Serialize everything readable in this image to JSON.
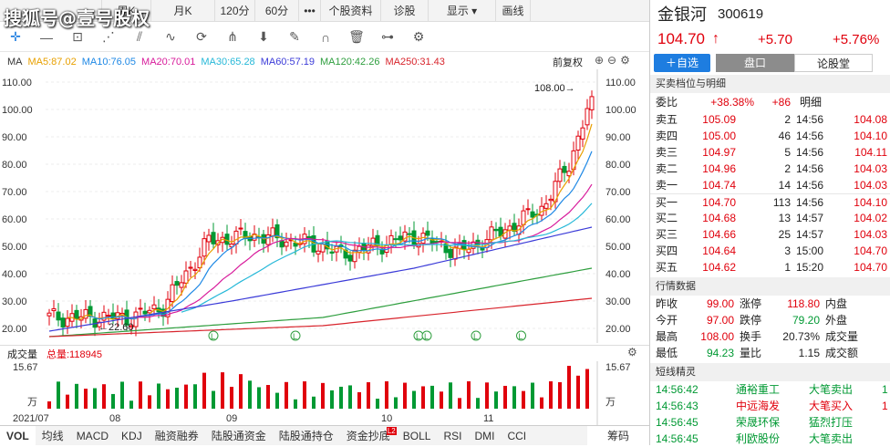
{
  "watermark": "搜狐号@壹号股权",
  "topbar": {
    "items": [
      "",
      "周K",
      "月K",
      "120分",
      "60分",
      "•••",
      "个股资料",
      "诊股",
      "显示 ▾",
      "画线"
    ]
  },
  "colors": {
    "up": "#e0000c",
    "down": "#009933"
  },
  "toolbar_icons": [
    "crosshair-icon",
    "line-icon",
    "rect-icon",
    "fan-icon",
    "parallel-icon",
    "wave-icon",
    "cycle-icon",
    "fork-icon",
    "arrow-down-icon",
    "pen-icon",
    "magnet-icon",
    "trash-icon",
    "split-icon",
    "settings-icon"
  ],
  "ma": {
    "label": "MA",
    "items": [
      {
        "label": "MA5:87.02",
        "color": "#e8a000"
      },
      {
        "label": "MA10:76.05",
        "color": "#1e88e5"
      },
      {
        "label": "MA20:70.01",
        "color": "#d81b9b"
      },
      {
        "label": "MA30:65.28",
        "color": "#26b8d8"
      },
      {
        "label": "MA60:57.19",
        "color": "#3b3bd8"
      },
      {
        "label": "MA120:42.26",
        "color": "#2e9e3e"
      },
      {
        "label": "MA250:31.43",
        "color": "#d8242c"
      }
    ],
    "adjust": "前复权",
    "high_label": "108.00→",
    "low_label": "←22.60"
  },
  "vol": {
    "label": "成交量",
    "total": "总量:118945",
    "axis_top": "15.67",
    "axis_unit": "万"
  },
  "xaxis": [
    "2021/07",
    "08",
    "09",
    "10",
    "11"
  ],
  "yaxis": [
    "110.00",
    "100.00",
    "90.00",
    "80.00",
    "70.00",
    "60.00",
    "50.00",
    "40.00",
    "30.00",
    "20.00"
  ],
  "bottom_tabs": [
    "VOL",
    "均线",
    "MACD",
    "KDJ",
    "融资融券",
    "陆股通资金",
    "陆股通持仓",
    "资金抄底",
    "BOLL",
    "RSI",
    "DMI",
    "CCI"
  ],
  "bottom_badge": "L2",
  "bottom_right": "筹码",
  "stock": {
    "name": "金银河",
    "code": "300619",
    "price": "104.70",
    "arrow": "↑",
    "change": "+5.70",
    "pct": "+5.76%"
  },
  "tabs": {
    "add": "＋自选",
    "quote": "盘口",
    "forum": "论股堂"
  },
  "orderbook": {
    "title": "买卖档位与明细",
    "weibi_label": "委比",
    "weibi": "+38.38%",
    "weicha": "+86",
    "detail_label": "明细",
    "sells": [
      {
        "label": "卖五",
        "price": "105.09",
        "vol": "2"
      },
      {
        "label": "卖四",
        "price": "105.00",
        "vol": "46"
      },
      {
        "label": "卖三",
        "price": "104.97",
        "vol": "5"
      },
      {
        "label": "卖二",
        "price": "104.96",
        "vol": "2"
      },
      {
        "label": "卖一",
        "price": "104.74",
        "vol": "14"
      }
    ],
    "buys": [
      {
        "label": "买一",
        "price": "104.70",
        "vol": "113"
      },
      {
        "label": "买二",
        "price": "104.68",
        "vol": "13"
      },
      {
        "label": "买三",
        "price": "104.66",
        "vol": "25"
      },
      {
        "label": "买四",
        "price": "104.64",
        "vol": "3"
      },
      {
        "label": "买五",
        "price": "104.62",
        "vol": "1"
      }
    ],
    "details": [
      {
        "time": "14:56",
        "price": "104.08"
      },
      {
        "time": "14:56",
        "price": "104.10"
      },
      {
        "time": "14:56",
        "price": "104.11"
      },
      {
        "time": "14:56",
        "price": "104.03"
      },
      {
        "time": "14:56",
        "price": "104.03"
      },
      {
        "time": "14:56",
        "price": "104.10"
      },
      {
        "time": "14:57",
        "price": "104.02"
      },
      {
        "time": "14:57",
        "price": "104.03"
      },
      {
        "time": "15:00",
        "price": "104.70"
      },
      {
        "time": "15:20",
        "price": "104.70"
      }
    ]
  },
  "market": {
    "title": "行情数据",
    "rows": [
      {
        "l1": "昨收",
        "v1": "99.00",
        "l2": "涨停",
        "v2": "118.80",
        "l3": "内盘"
      },
      {
        "l1": "今开",
        "v1": "97.00",
        "l2": "跌停",
        "v2": "79.20",
        "l3": "外盘"
      },
      {
        "l1": "最高",
        "v1": "108.00",
        "l2": "换手",
        "v2": "20.73%",
        "l3": "成交量"
      },
      {
        "l1": "最低",
        "v1": "94.23",
        "l2": "量比",
        "v2": "1.15",
        "l3": "成交额"
      }
    ]
  },
  "shortline": {
    "title": "短线精灵",
    "rows": [
      {
        "time": "14:56:42",
        "name": "通裕重工",
        "event": "大笔卖出",
        "extra": "1"
      },
      {
        "time": "14:56:43",
        "name": "中远海发",
        "event": "大笔买入",
        "extra": "1"
      },
      {
        "time": "14:56:45",
        "name": "荣晟环保",
        "event": "猛烈打压",
        "extra": ""
      },
      {
        "time": "14:56:45",
        "name": "利欧股份",
        "event": "大笔卖出",
        "extra": ""
      }
    ]
  }
}
